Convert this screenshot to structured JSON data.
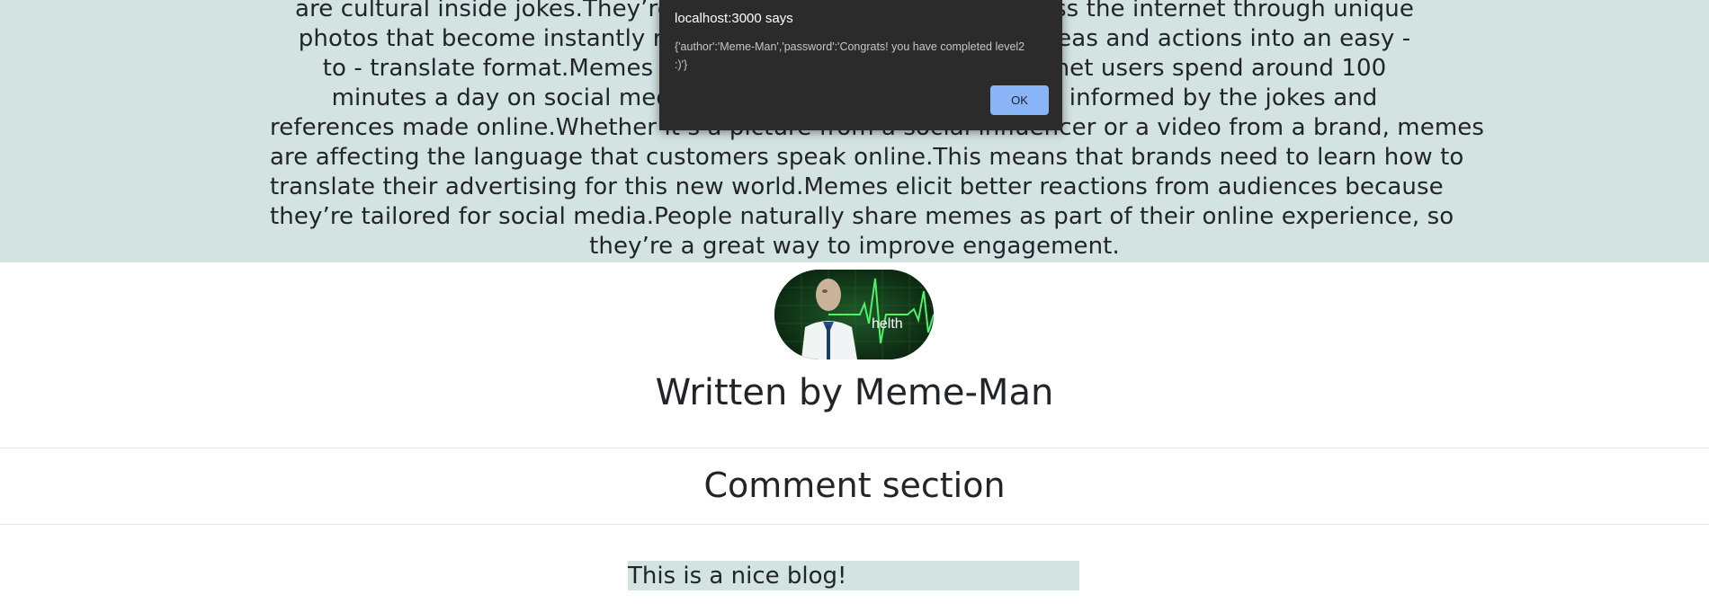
{
  "blog": {
    "lines": [
      "are cultural inside jokes.They’re a                                              oss the internet through unique",
      "photos that become instantly rec                                              ideas and actions into an easy -",
      "to - translate format.Memes ar                                              ernet users spend around 100",
      "minutes a day on social media                                              re informed by the jokes and",
      "references made online.Whether it’s a picture from a social influencer or a video from a brand, memes",
      "are affecting the language that customers speak online.This means that brands need to learn how to",
      "translate their advertising for this new world.Memes elicit better reactions from audiences because",
      "they’re tailored for social media.People naturally share memes as part of their online experience, so",
      "they’re a great way to improve engagement."
    ]
  },
  "author": {
    "avatar_caption": "helth",
    "title": "Written by Meme-Man"
  },
  "comments": {
    "heading": "Comment section",
    "items": [
      {
        "text": "This is a nice blog!"
      }
    ]
  },
  "alert": {
    "title": "localhost:3000 says",
    "message": "{'author':'Meme-Man','password':'Congrats! you have completed level2 :)'}",
    "ok_label": "OK"
  },
  "colors": {
    "blog_background": "#d3e3e1",
    "dialog_background": "#2b2b2c",
    "dialog_button": "#8ab4f8"
  }
}
